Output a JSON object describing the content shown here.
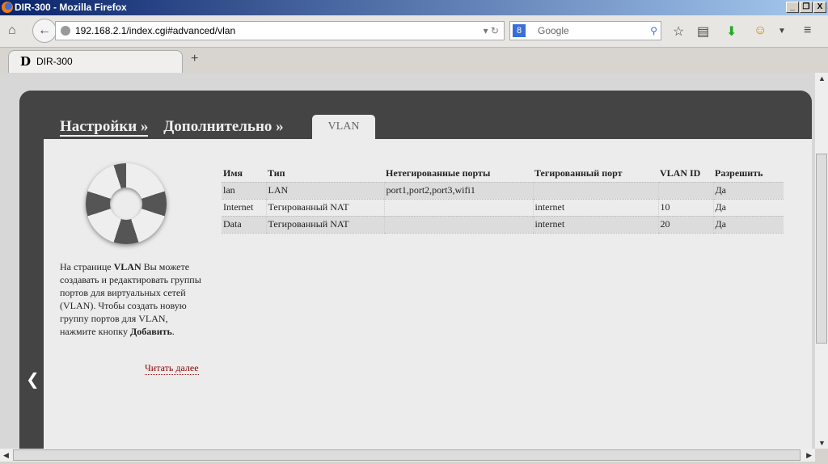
{
  "window": {
    "title": "DIR-300 - Mozilla Firefox"
  },
  "browser": {
    "url": "192.168.2.1/index.cgi#advanced/vlan",
    "search_placeholder": "Google",
    "tab_title": "DIR-300",
    "tab_logo": "D"
  },
  "breadcrumb": {
    "items": [
      "Настройки »",
      "Дополнительно »"
    ],
    "current": "VLAN"
  },
  "help": {
    "text_parts": [
      "На странице ",
      "VLAN",
      " Вы можете создавать и редактировать группы портов для виртуальных сетей (VLAN). Чтобы создать новую группу портов для VLAN, нажмите кнопку ",
      "Добавить",
      "."
    ],
    "read_more": "Читать далее"
  },
  "table": {
    "headers": [
      "Имя",
      "Тип",
      "Нетегированные порты",
      "Тегированный порт",
      "VLAN ID",
      "Разрешить"
    ],
    "rows": [
      [
        "lan",
        "LAN",
        "port1,port2,port3,wifi1",
        "",
        "",
        "Да"
      ],
      [
        "Internet",
        "Тегированный NAT",
        "",
        "internet",
        "10",
        "Да"
      ],
      [
        "Data",
        "Тегированный NAT",
        "",
        "internet",
        "20",
        "Да"
      ]
    ]
  }
}
